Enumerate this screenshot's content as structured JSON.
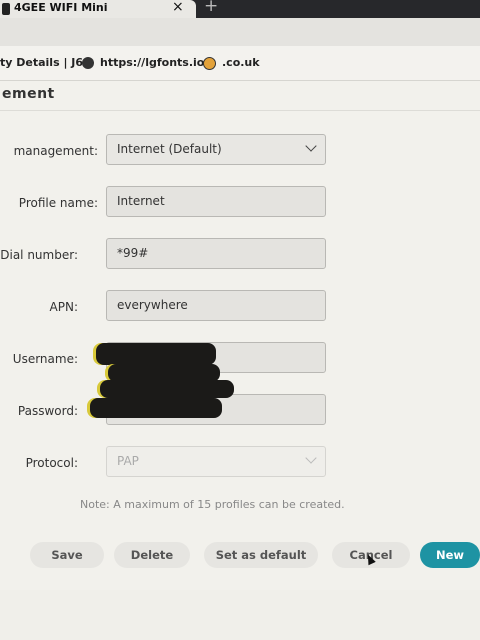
{
  "browser": {
    "tab_title": "4GEE WIFI Mini",
    "tab_close": "×",
    "new_tab": "+",
    "bookmarks": [
      {
        "label": "ty Details | J6"
      },
      {
        "label": "https://lgfonts.io/"
      },
      {
        "label": ".co.uk"
      }
    ]
  },
  "page": {
    "title": "ement"
  },
  "form": {
    "management_label": "management:",
    "management_value": "Internet (Default)",
    "profile_name_label": "Profile name:",
    "profile_name_value": "Internet",
    "dial_number_label": "Dial number:",
    "dial_number_value": "*99#",
    "apn_label": "APN:",
    "apn_value": "everywhere",
    "username_label": "Username:",
    "password_label": "Password:",
    "protocol_label": "Protocol:",
    "protocol_value": "PAP"
  },
  "note": "Note: A maximum of 15 profiles can be created.",
  "buttons": {
    "save": "Save",
    "delete": "Delete",
    "set_default": "Set as default",
    "cancel": "Cancel",
    "new": "New"
  },
  "colors": {
    "primary": "#1e93a3",
    "background": "#f2f1ec"
  }
}
